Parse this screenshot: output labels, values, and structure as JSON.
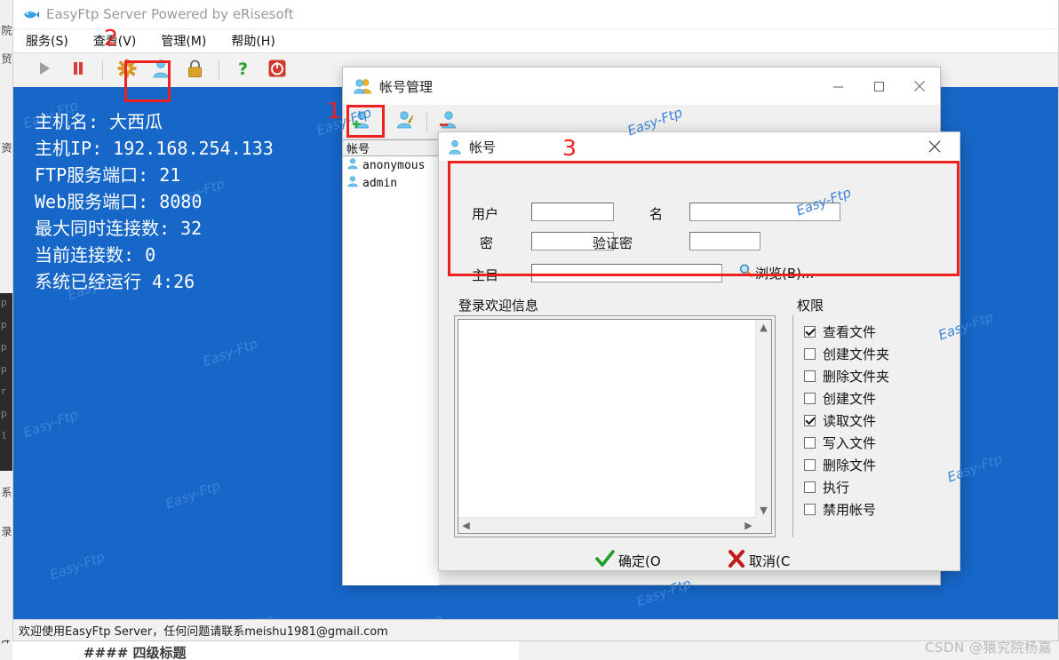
{
  "background": {
    "markdown_snippet": "#### 四级标题",
    "csdn_watermark": "CSDN @猿究院杨嘉",
    "editor_gutter": [
      "p",
      "p",
      "p",
      "p",
      "r",
      "p",
      "l"
    ],
    "left_vertical_texts": [
      "院",
      "贸",
      "资",
      "系",
      "录",
      "t"
    ]
  },
  "app": {
    "title": "EasyFtp Server Powered by eRisesoft",
    "title_icon": "fish-icon",
    "menu": [
      {
        "name": "menu-service",
        "label": "服务(S)"
      },
      {
        "name": "menu-view",
        "label": "查看(V)"
      },
      {
        "name": "menu-manage",
        "label": "管理(M)"
      },
      {
        "name": "menu-help",
        "label": "帮助(H)"
      }
    ],
    "toolbar": [
      {
        "name": "start-button",
        "icon": "play-icon",
        "state": "disabled"
      },
      {
        "name": "pause-button",
        "icon": "pause-icon",
        "state": "enabled"
      },
      {
        "name": "settings-button",
        "icon": "gear-icon",
        "state": "enabled"
      },
      {
        "name": "accounts-button",
        "icon": "user-icon",
        "state": "selected"
      },
      {
        "name": "lock-button",
        "icon": "lock-icon",
        "state": "enabled"
      },
      {
        "name": "help-button",
        "icon": "question-icon",
        "state": "enabled"
      },
      {
        "name": "power-button",
        "icon": "power-icon",
        "state": "enabled"
      }
    ],
    "info": [
      "主机名: 大西瓜",
      "主机IP: 192.168.254.133",
      "FTP服务端口: 21",
      "Web服务端口: 8080",
      "最大同时连接数: 32",
      "当前连接数: 0",
      "系统已经运行 4:26"
    ],
    "panel_watermark": "Easy-Ftp",
    "status_text": "欢迎使用EasyFtp Server，任何问题请联系meishu1981@gmail.com",
    "panel_color": "#1667c8"
  },
  "account_manager": {
    "title": "帐号管理",
    "title_icon": "users-icon",
    "window_controls": [
      {
        "name": "minimize-button",
        "glyph": "—"
      },
      {
        "name": "maximize-button",
        "glyph": "▢"
      },
      {
        "name": "close-button",
        "glyph": "✕"
      }
    ],
    "toolbar": [
      {
        "name": "add-account-button",
        "icon": "user-add-icon"
      },
      {
        "name": "edit-account-button",
        "icon": "user-edit-icon"
      },
      {
        "name": "delete-account-button",
        "icon": "user-delete-icon"
      }
    ],
    "list_header": "帐号",
    "accounts": [
      {
        "name": "anonymous",
        "icon": "user-icon"
      },
      {
        "name": "admin",
        "icon": "user-icon"
      }
    ]
  },
  "account_dialog": {
    "title": "帐号",
    "title_icon": "user-icon",
    "close_glyph": "✕",
    "fields": {
      "user_label": "用户",
      "user_value": "",
      "name_label": "名",
      "name_value": "",
      "password_label": "密",
      "password_value": "",
      "confirm_label": "验证密",
      "confirm_value": "",
      "home_label": "主目",
      "home_value": "",
      "browse_label": "浏览(B)...",
      "browse_icon": "magnifier-icon"
    },
    "welcome_label": "登录欢迎信息",
    "welcome_value": "",
    "permissions_label": "权限",
    "permissions": [
      {
        "label": "查看文件",
        "checked": true
      },
      {
        "label": "创建文件夹",
        "checked": false
      },
      {
        "label": "删除文件夹",
        "checked": false
      },
      {
        "label": "创建文件",
        "checked": false
      },
      {
        "label": "读取文件",
        "checked": true
      },
      {
        "label": "写入文件",
        "checked": false
      },
      {
        "label": "删除文件",
        "checked": false
      },
      {
        "label": "执行",
        "checked": false
      },
      {
        "label": "禁用帐号",
        "checked": false
      }
    ],
    "ok_label": "确定(O",
    "ok_icon": "green-check-icon",
    "cancel_label": "取消(C",
    "cancel_icon": "red-x-icon"
  },
  "annotations": [
    {
      "number": "1",
      "target": "accounts-button"
    },
    {
      "number": "2",
      "target": "add-account-button"
    },
    {
      "number": "3",
      "target": "account-dialog-form"
    }
  ],
  "colors": {
    "accent_blue": "#1667c8",
    "annotation_red": "#ef2020",
    "watermark_gray": "#b9b9b9"
  }
}
